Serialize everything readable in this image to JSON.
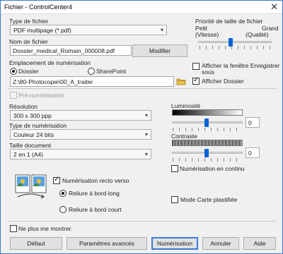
{
  "window": {
    "title": "Fichier - ControlCenter4",
    "close_glyph": "✕"
  },
  "file_type": {
    "label": "Type de fichier",
    "value": "PDF multipage (*.pdf)"
  },
  "file_size_priority": {
    "label": "Priorité de taille de fichier",
    "left_label_1": "Petit",
    "left_label_2": "(Vitesse)",
    "right_label_1": "Grand",
    "right_label_2": "(Qualité)",
    "level": 0.5
  },
  "file_name": {
    "label": "Nom de fichier",
    "value": "Dossier_medical_Romain_000008.pdf",
    "modify_button": "Modifier"
  },
  "scan_location": {
    "label": "Emplacement de numérisation",
    "option_folder": "Dossier",
    "option_sharepoint": "SharePoint",
    "selected": "Dossier",
    "path": "Z:\\80-Photocopie\\00_A_traiter"
  },
  "show_save_window": {
    "label_1": "Afficher la fenêtre Enregistrer",
    "label_2": "sous",
    "checked": false
  },
  "show_folder": {
    "label": "Afficher Dossier",
    "checked": true
  },
  "pre_scan": {
    "label": "Pré-numérisation",
    "checked": false,
    "enabled": false
  },
  "resolution": {
    "label": "Résolution",
    "value": "300 x 300 ppp"
  },
  "scan_type": {
    "label": "Type de numérisation",
    "value": "Couleur 24 bits"
  },
  "document_size": {
    "label": "Taille document",
    "value": "2 en 1 (A4)"
  },
  "brightness": {
    "label": "Luminosité",
    "value": "0",
    "level": 0.5
  },
  "contrast": {
    "label": "Contraste",
    "value": "0",
    "level": 0.5
  },
  "continuous_scan": {
    "label": "Numérisation en continu",
    "checked": false
  },
  "duplex": {
    "label": "Numérisation recto verso",
    "checked": true,
    "option_long": "Reliure à bord long",
    "option_short": "Reliure à bord court",
    "selected": "Reliure à bord long"
  },
  "plastic_card_mode": {
    "label": "Mode Carte plastifiée",
    "checked": false
  },
  "dont_show_again": {
    "label": "Ne plus me montrer.",
    "checked": false
  },
  "buttons": {
    "default": "Défaut",
    "advanced": "Paramètres avancés",
    "scan": "Numérisation",
    "cancel": "Annuler",
    "help": "Aide"
  },
  "icons": {
    "dropdown": "▾",
    "folder": "folder-icon",
    "duplex_pages": "duplex-pages-icon"
  },
  "colors": {
    "accent": "#0a64d6",
    "window_border": "#3c78c8"
  }
}
